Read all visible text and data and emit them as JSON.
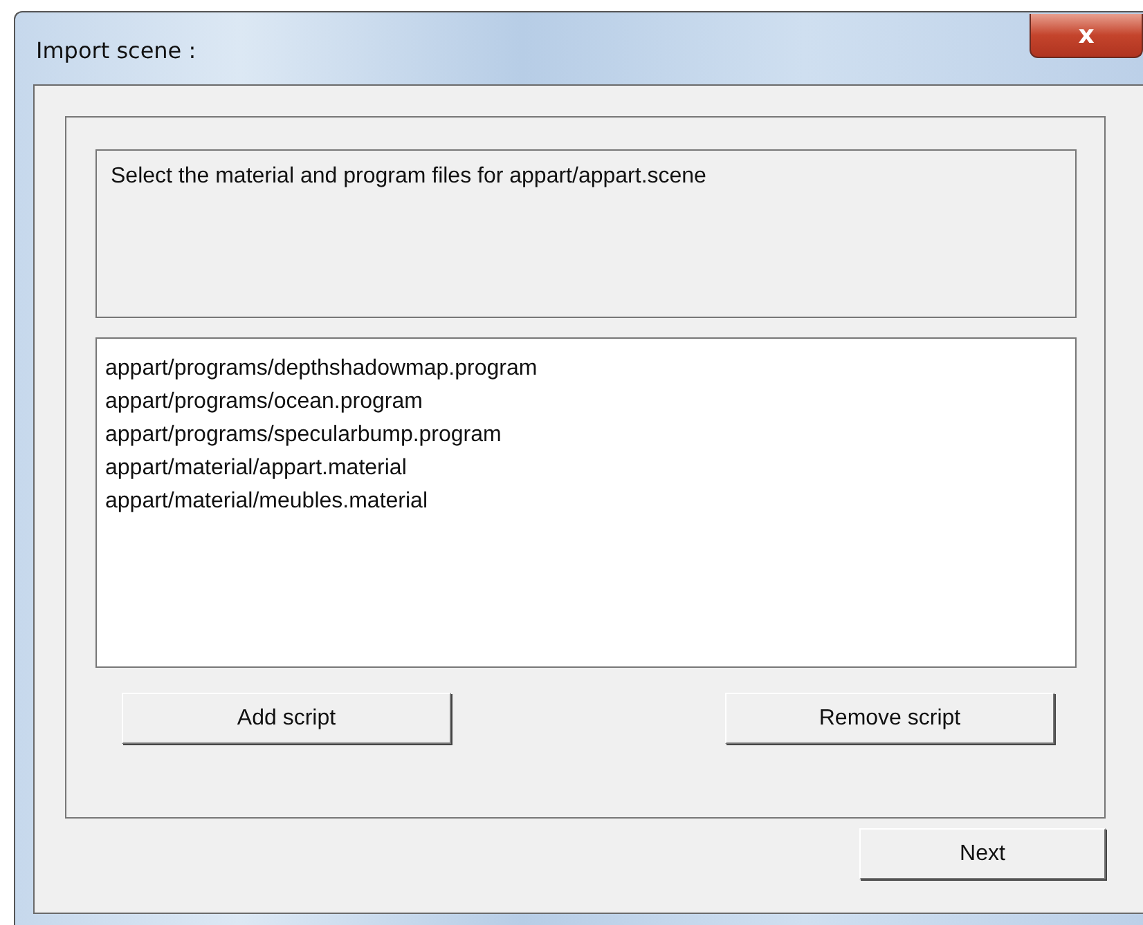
{
  "window": {
    "title": "Import scene :",
    "close": "x"
  },
  "message": "Select the material and program files for appart/appart.scene",
  "files": [
    "appart/programs/depthshadowmap.program",
    "appart/programs/ocean.program",
    "appart/programs/specularbump.program",
    "appart/material/appart.material",
    "appart/material/meubles.material"
  ],
  "buttons": {
    "add": "Add script",
    "remove": "Remove script",
    "next": "Next"
  }
}
